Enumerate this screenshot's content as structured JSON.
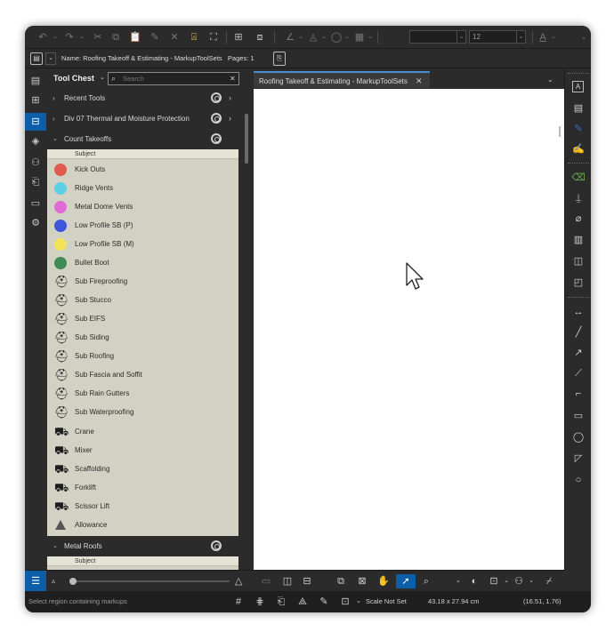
{
  "toolbar": {
    "font_size_value": "12"
  },
  "namebar": {
    "name_label": "Name:",
    "name_value": "Roofing Takeoff & Estimating - MarkupToolSets",
    "pages_label": "Pages:",
    "pages_value": "1"
  },
  "tool_chest": {
    "title": "Tool Chest",
    "search_placeholder": "Search",
    "groups": [
      {
        "label": "Recent Tools",
        "expanded": false
      },
      {
        "label": "Div 07 Thermal and Moisture Protection",
        "expanded": false
      },
      {
        "label": "Count Takeoffs",
        "expanded": true
      },
      {
        "label": "Metal Roofs",
        "expanded": true
      }
    ],
    "subject_header": "Subject",
    "items": [
      {
        "label": "Kick Outs",
        "icon": "red-dot",
        "color": "#e05a4e"
      },
      {
        "label": "Ridge Vents",
        "icon": "cyan-dot",
        "color": "#5ed0e6"
      },
      {
        "label": "Metal Dome Vents",
        "icon": "magenta-dot",
        "color": "#e06ad6"
      },
      {
        "label": "Low Profile SB (P)",
        "icon": "blue-dot",
        "color": "#3f56d8"
      },
      {
        "label": "Low Profile SB (M)",
        "icon": "yellow-dot",
        "color": "#f4e25a"
      },
      {
        "label": "Bullet Boot",
        "icon": "green-dot",
        "color": "#3f8a55"
      },
      {
        "label": "Sub Fireproofing",
        "icon": "hardhat-icon"
      },
      {
        "label": "Sub Stucco",
        "icon": "hardhat-icon"
      },
      {
        "label": "Sub EIFS",
        "icon": "hardhat-icon"
      },
      {
        "label": "Sub Siding",
        "icon": "hardhat-icon"
      },
      {
        "label": "Sub Roofing",
        "icon": "hardhat-icon"
      },
      {
        "label": "Sub Fascia and Soffit",
        "icon": "hardhat-icon"
      },
      {
        "label": "Sub Rain Gutters",
        "icon": "hardhat-icon"
      },
      {
        "label": "Sub Waterproofing",
        "icon": "hardhat-icon"
      },
      {
        "label": "Crane",
        "icon": "equipment-icon"
      },
      {
        "label": "Mixer",
        "icon": "equipment-icon"
      },
      {
        "label": "Scaffolding",
        "icon": "equipment-icon"
      },
      {
        "label": "Forklift",
        "icon": "equipment-icon"
      },
      {
        "label": "Scissor Lift",
        "icon": "equipment-icon"
      },
      {
        "label": "Allowance",
        "icon": "triangle-icon"
      }
    ],
    "subject_header_2": "Subject"
  },
  "document": {
    "tab_label": "Roofing Takeoff & Estimating - MarkupToolSets"
  },
  "status": {
    "hint": "Select region containing markups",
    "scale": "Scale Not Set",
    "page_size": "43.18 x 27.94 cm",
    "coords": "(16.51, 1.76)"
  },
  "colors": {
    "accent": "#0d5ea8",
    "panel": "#2b2b2b",
    "list_bg": "#d2d2c4"
  }
}
